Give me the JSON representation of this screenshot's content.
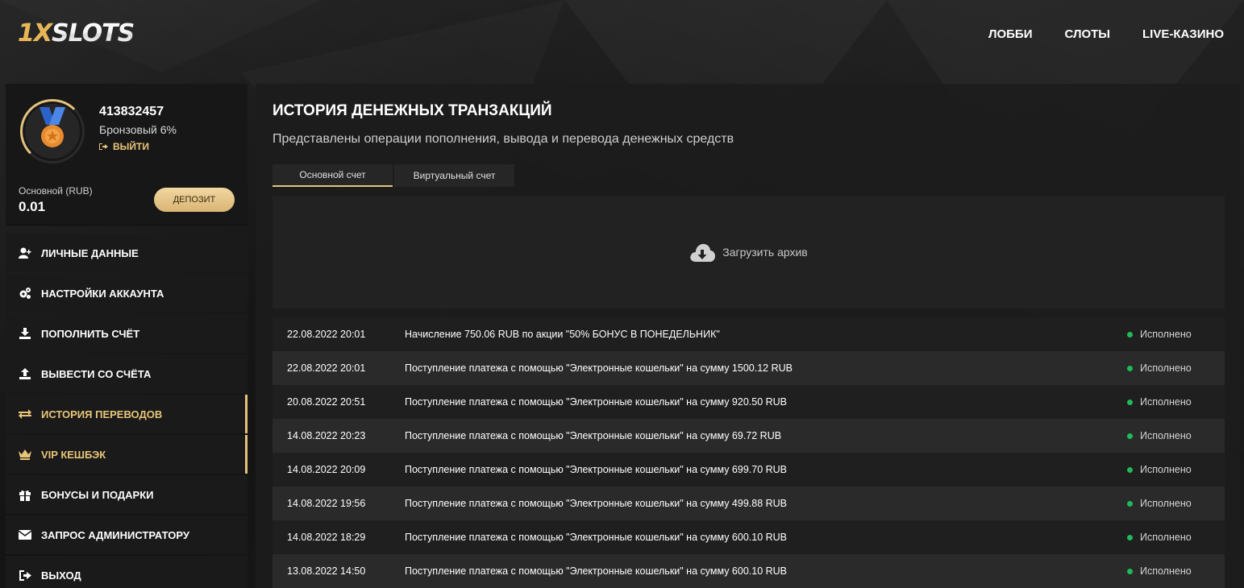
{
  "header": {
    "logo_prefix": "1X",
    "logo_rest": "SLOTS",
    "nav": [
      "ЛОББИ",
      "СЛОТЫ",
      "LIVE-КАЗИНО"
    ]
  },
  "profile": {
    "user_id": "413832457",
    "rank": "Бронзовый 6%",
    "logout_label": "ВЫЙТИ",
    "balance_label": "Основной (RUB)",
    "balance_value": "0.01",
    "deposit_label": "ДЕПОЗИТ",
    "rank_progress_percent": 6
  },
  "menu": [
    {
      "label": "ЛИЧНЫЕ ДАННЫЕ",
      "icon": "user-plus-icon"
    },
    {
      "label": "НАСТРОЙКИ АККАУНТА",
      "icon": "gears-icon"
    },
    {
      "label": "ПОПОЛНИТЬ СЧЁТ",
      "icon": "download-icon"
    },
    {
      "label": "ВЫВЕСТИ СО СЧЁТА",
      "icon": "upload-icon"
    },
    {
      "label": "ИСТОРИЯ ПЕРЕВОДОВ",
      "icon": "transfer-arrows-icon",
      "active": true
    },
    {
      "label": "VIP КЕШБЭК",
      "icon": "crown-icon",
      "active": true
    },
    {
      "label": "БОНУСЫ И ПОДАРКИ",
      "icon": "gift-icon"
    },
    {
      "label": "ЗАПРОС АДМИНИСТРАТОРУ",
      "icon": "envelope-icon"
    },
    {
      "label": "ВЫХОД",
      "icon": "logout-icon"
    }
  ],
  "main": {
    "title": "ИСТОРИЯ ДЕНЕЖНЫХ ТРАНЗАКЦИЙ",
    "subtitle": "Представлены операции пополнения, вывода и перевода денежных средств",
    "tabs": [
      {
        "label": "Основной счет",
        "active": true
      },
      {
        "label": "Виртуальный счет",
        "active": false
      }
    ],
    "download_label": "Загрузить архив",
    "transactions": [
      {
        "date": "22.08.2022 20:01",
        "desc": "Начисление 750.06 RUB по акции \"50% БОНУС В ПОНЕДЕЛЬНИК\"",
        "status": "Исполнено"
      },
      {
        "date": "22.08.2022 20:01",
        "desc": "Поступление платежа с помощью \"Электронные кошельки\" на сумму 1500.12 RUB",
        "status": "Исполнено"
      },
      {
        "date": "20.08.2022 20:51",
        "desc": "Поступление платежа с помощью \"Электронные кошельки\" на сумму 920.50 RUB",
        "status": "Исполнено"
      },
      {
        "date": "14.08.2022 20:23",
        "desc": "Поступление платежа с помощью \"Электронные кошельки\" на сумму 69.72 RUB",
        "status": "Исполнено"
      },
      {
        "date": "14.08.2022 20:09",
        "desc": "Поступление платежа с помощью \"Электронные кошельки\" на сумму 699.70 RUB",
        "status": "Исполнено"
      },
      {
        "date": "14.08.2022 19:56",
        "desc": "Поступление платежа с помощью \"Электронные кошельки\" на сумму 499.88 RUB",
        "status": "Исполнено"
      },
      {
        "date": "14.08.2022 18:29",
        "desc": "Поступление платежа с помощью \"Электронные кошельки\" на сумму 600.10 RUB",
        "status": "Исполнено"
      },
      {
        "date": "13.08.2022 14:50",
        "desc": "Поступление платежа с помощью \"Электронные кошельки\" на сумму 600.10 RUB",
        "status": "Исполнено"
      }
    ]
  },
  "colors": {
    "accent_gold": "#e3c27e",
    "status_green": "#1fba5a"
  }
}
